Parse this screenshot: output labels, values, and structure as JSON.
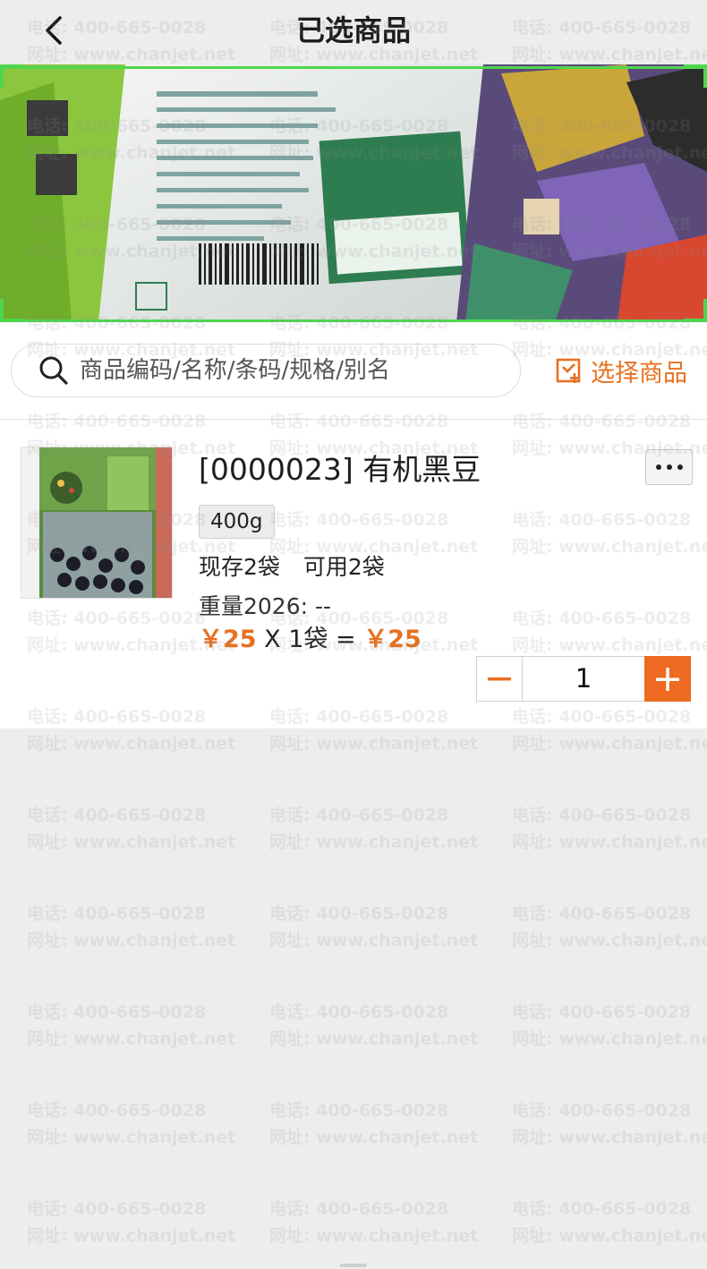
{
  "header": {
    "title": "已选商品"
  },
  "search": {
    "placeholder": "商品编码/名称/条码/规格/别名",
    "select_label": "选择商品"
  },
  "product": {
    "name": "[0000023] 有机黑豆",
    "spec": "400g",
    "stock": "现存2袋",
    "available": "可用2袋",
    "weight": "重量2026:  --",
    "unit_price": "￥25",
    "multiply": " X 1袋 = ",
    "total": "￥25",
    "quantity": "1"
  },
  "watermark": {
    "phone": "电话: 400-665-0028",
    "site": "网址: www.chanjet.net"
  },
  "colors": {
    "accent": "#e8701f",
    "scan": "#4fd64f",
    "background": "#ededed"
  }
}
